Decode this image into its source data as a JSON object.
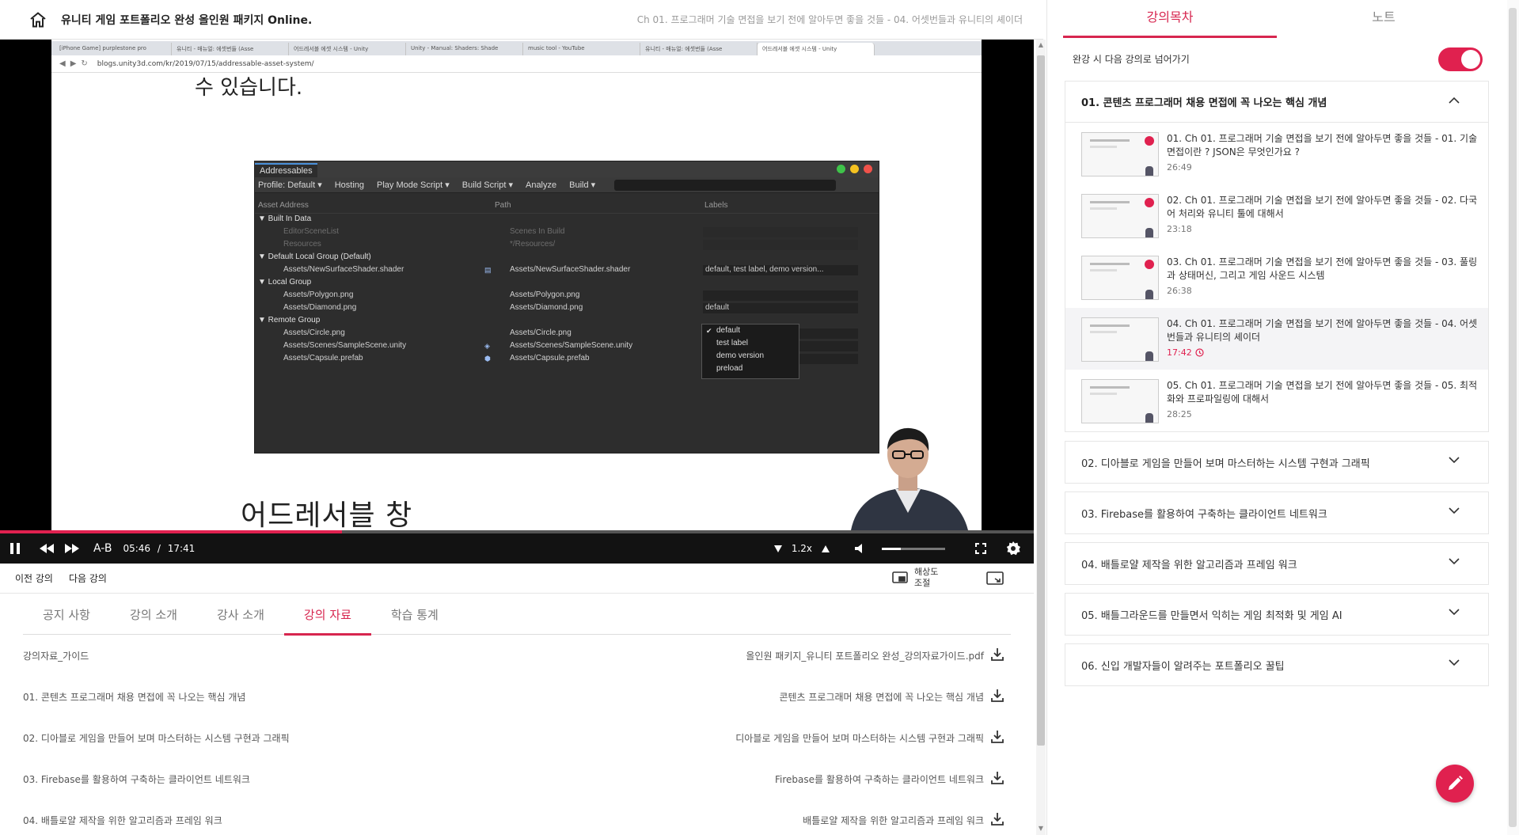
{
  "header": {
    "course_title": "유니티 게임 포트폴리오 완성 올인원 패키지 Online.",
    "current_lecture": "Ch 01. 프로그래머 기술 면접을 보기 전에 알아두면 좋을 것들 - 04. 어셋번들과 유니티의 셰이더"
  },
  "video": {
    "browser_tabs": [
      "[iPhone Game] purplestone pro",
      "유니티 - 매뉴얼: 에셋번들 (Asse",
      "어드레서블 에셋 시스템 - Unity",
      "Unity - Manual: Shaders: Shade",
      "music tool - YouTube",
      "유니티 - 매뉴얼: 에셋번들 (Asse",
      "어드레서블 에셋 시스템 - Unity"
    ],
    "url": "blogs.unity3d.com/kr/2019/07/15/addressable-asset-system/",
    "slide_top_text": "수 있습니다.",
    "slide_heading": "어드레서블 창",
    "addressables": {
      "window_title": "Addressables",
      "toolbar": [
        "Profile: Default ▾",
        "Hosting",
        "Play Mode Script ▾",
        "Build Script ▾",
        "Analyze",
        "Build ▾"
      ],
      "col_asset": "Asset Address",
      "col_path": "Path",
      "col_labels": "Labels",
      "rows": [
        {
          "name": "▼ Built In Data",
          "indent": 0,
          "path": "",
          "label": "",
          "dim": false,
          "group": true
        },
        {
          "name": "EditorSceneList",
          "indent": 1,
          "path": "Scenes In Build",
          "label": "",
          "dim": true
        },
        {
          "name": "Resources",
          "indent": 1,
          "path": "*/Resources/",
          "label": "",
          "dim": true
        },
        {
          "name": "▼ Default Local Group (Default)",
          "indent": 0,
          "path": "",
          "label": "",
          "dim": false,
          "group": true
        },
        {
          "name": "Assets/NewSurfaceShader.shader",
          "indent": 1,
          "path": "Assets/NewSurfaceShader.shader",
          "label": "default, test label, demo version...",
          "dim": false
        },
        {
          "name": "▼ Local Group",
          "indent": 0,
          "path": "",
          "label": "",
          "dim": false,
          "group": true
        },
        {
          "name": "Assets/Polygon.png",
          "indent": 1,
          "path": "Assets/Polygon.png",
          "label": "",
          "dim": false
        },
        {
          "name": "Assets/Diamond.png",
          "indent": 1,
          "path": "Assets/Diamond.png",
          "label": "default",
          "dim": false
        },
        {
          "name": "▼ Remote Group",
          "indent": 0,
          "path": "",
          "label": "",
          "dim": false,
          "group": true
        },
        {
          "name": "Assets/Circle.png",
          "indent": 1,
          "path": "Assets/Circle.png",
          "label": "",
          "dim": false
        },
        {
          "name": "Assets/Scenes/SampleScene.unity",
          "indent": 1,
          "path": "Assets/Scenes/SampleScene.unity",
          "label": "",
          "dim": false
        },
        {
          "name": "Assets/Capsule.prefab",
          "indent": 1,
          "path": "Assets/Capsule.prefab",
          "label": "",
          "dim": false
        }
      ],
      "label_options": [
        "default",
        "test label",
        "demo version",
        "preload"
      ]
    },
    "progress_fraction": 0.3311,
    "ab_label": "A-B",
    "current_time": "05:46",
    "time_sep": "/",
    "duration": "17:41",
    "playback_rate": "1.2x",
    "volume_fraction": 0.3
  },
  "subbar": {
    "prev": "이전 강의",
    "next": "다음 강의",
    "quality_line1": "해상도",
    "quality_line2": "조절"
  },
  "tabs": [
    {
      "label": "공지 사항",
      "active": false
    },
    {
      "label": "강의 소개",
      "active": false
    },
    {
      "label": "강사 소개",
      "active": false
    },
    {
      "label": "강의 자료",
      "active": true
    },
    {
      "label": "학습 통계",
      "active": false
    }
  ],
  "materials": [
    {
      "left": "강의자료_가이드",
      "right": "올인원 패키지_유니티 포트폴리오 완성_강의자료가이드.pdf"
    },
    {
      "left": "01. 콘텐츠 프로그래머 채용 면접에 꼭 나오는 핵심 개념",
      "right": "콘텐츠 프로그래머 채용 면접에 꼭 나오는 핵심 개념"
    },
    {
      "left": "02. 디아블로 게임을 만들어 보며 마스터하는 시스템 구현과 그래픽",
      "right": "디아블로 게임을 만들어 보며 마스터하는 시스템 구현과 그래픽"
    },
    {
      "left": "03. Firebase를 활용하여 구축하는 클라이언트 네트워크",
      "right": "Firebase를 활용하여 구축하는 클라이언트 네트워크"
    },
    {
      "left": "04. 배틀로얄 제작을 위한 알고리즘과 프레임 워크",
      "right": "배틀로얄 제작을 위한 알고리즘과 프레임 워크"
    }
  ],
  "sidebar": {
    "tab_toc": "강의목차",
    "tab_note": "노트",
    "autoplay_label": "완강 시 다음 강의로 넘어가기",
    "autoplay_on": true,
    "open_section": "01. 콘텐츠 프로그래머 채용 면접에 꼭 나오는 핵심 개념",
    "lessons": [
      {
        "title": "01. Ch 01. 프로그래머 기술 면접을 보기 전에 알아두면 좋을 것들 - 01. 기술 면접이란 ? JSON은 무엇인가요 ?",
        "duration": "26:49",
        "done": true,
        "current": false
      },
      {
        "title": "02. Ch 01. 프로그래머 기술 면접을 보기 전에 알아두면 좋을 것들 - 02. 다국어 처리와 유니티 툴에 대해서",
        "duration": "23:18",
        "done": true,
        "current": false
      },
      {
        "title": "03. Ch 01. 프로그래머 기술 면접을 보기 전에 알아두면 좋을 것들 - 03. 풀링과 상태머신, 그리고 게임 사운드 시스템",
        "duration": "26:38",
        "done": true,
        "current": false
      },
      {
        "title": "04. Ch 01. 프로그래머 기술 면접을 보기 전에 알아두면 좋을 것들 - 04. 어셋번들과 유니티의 셰이더",
        "duration": "17:42",
        "done": false,
        "current": true
      },
      {
        "title": "05. Ch 01. 프로그래머 기술 면접을 보기 전에 알아두면 좋을 것들 - 05. 최적화와 프로파일링에 대해서",
        "duration": "28:25",
        "done": false,
        "current": false
      }
    ],
    "sections": [
      "02. 디아블로 게임을 만들어 보며 마스터하는 시스템 구현과 그래픽",
      "03. Firebase를 활용하여 구축하는 클라이언트 네트워크",
      "04. 배틀로얄 제작을 위한 알고리즘과 프레임 워크",
      "05. 배틀그라운드를 만들면서 익히는 게임 최적화 및 게임 AI",
      "06. 신입 개발자들이 알려주는 포트폴리오 꿀팁"
    ]
  },
  "colors": {
    "accent": "#e0214f",
    "tab_accent": "#d7264f"
  }
}
